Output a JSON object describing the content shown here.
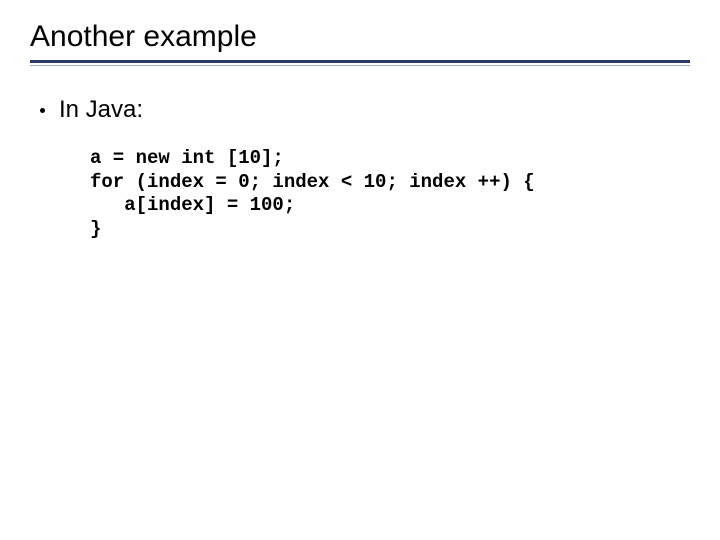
{
  "title": "Another example",
  "bullet1": "In Java:",
  "code": "a = new int [10];\nfor (index = 0; index < 10; index ++) {\n   a[index] = 100;\n}"
}
